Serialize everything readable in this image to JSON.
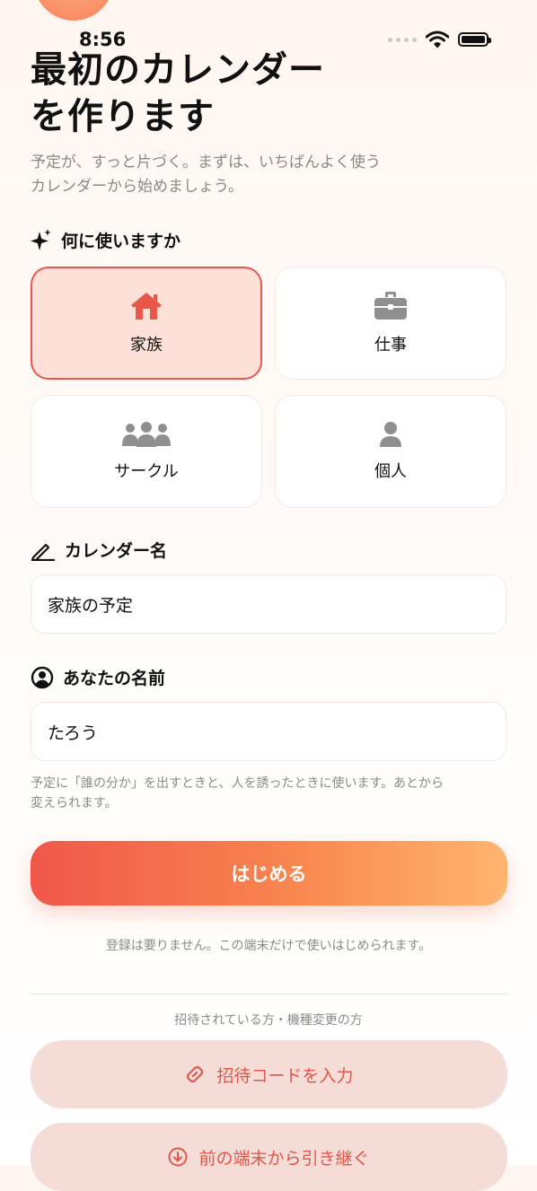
{
  "status": {
    "time": "8:56"
  },
  "header": {
    "title_line1": "最初のカレンダー",
    "title_line2": "を作ります",
    "subtitle_line1": "予定が、すっと片づく。まずは、いちばんよく使う",
    "subtitle_line2": "カレンダーから始めましょう。"
  },
  "usage": {
    "heading": "何に使いますか",
    "options": [
      {
        "label": "家族",
        "icon": "house-icon",
        "selected": true
      },
      {
        "label": "仕事",
        "icon": "briefcase-icon",
        "selected": false
      },
      {
        "label": "サークル",
        "icon": "group-icon",
        "selected": false
      },
      {
        "label": "個人",
        "icon": "person-icon",
        "selected": false
      }
    ]
  },
  "calendar_name": {
    "heading": "カレンダー名",
    "value": "家族の予定"
  },
  "your_name": {
    "heading": "あなたの名前",
    "value": "たろう",
    "hint_line1": "予定に「誰の分か」を出すときと、人を誘ったときに使います。あとから",
    "hint_line2": "変えられます。"
  },
  "start_button": "はじめる",
  "no_signup_note": "登録は要りません。この端末だけで使いはじめられます。",
  "invite_section": {
    "caption": "招待されている方・機種変更の方",
    "invite_code_button": "招待コードを入力",
    "transfer_button": "前の端末から引き継ぐ"
  },
  "colors": {
    "accent": "#e8574a",
    "accent_light": "#fde1d9",
    "gradient_end": "#ffb570"
  }
}
